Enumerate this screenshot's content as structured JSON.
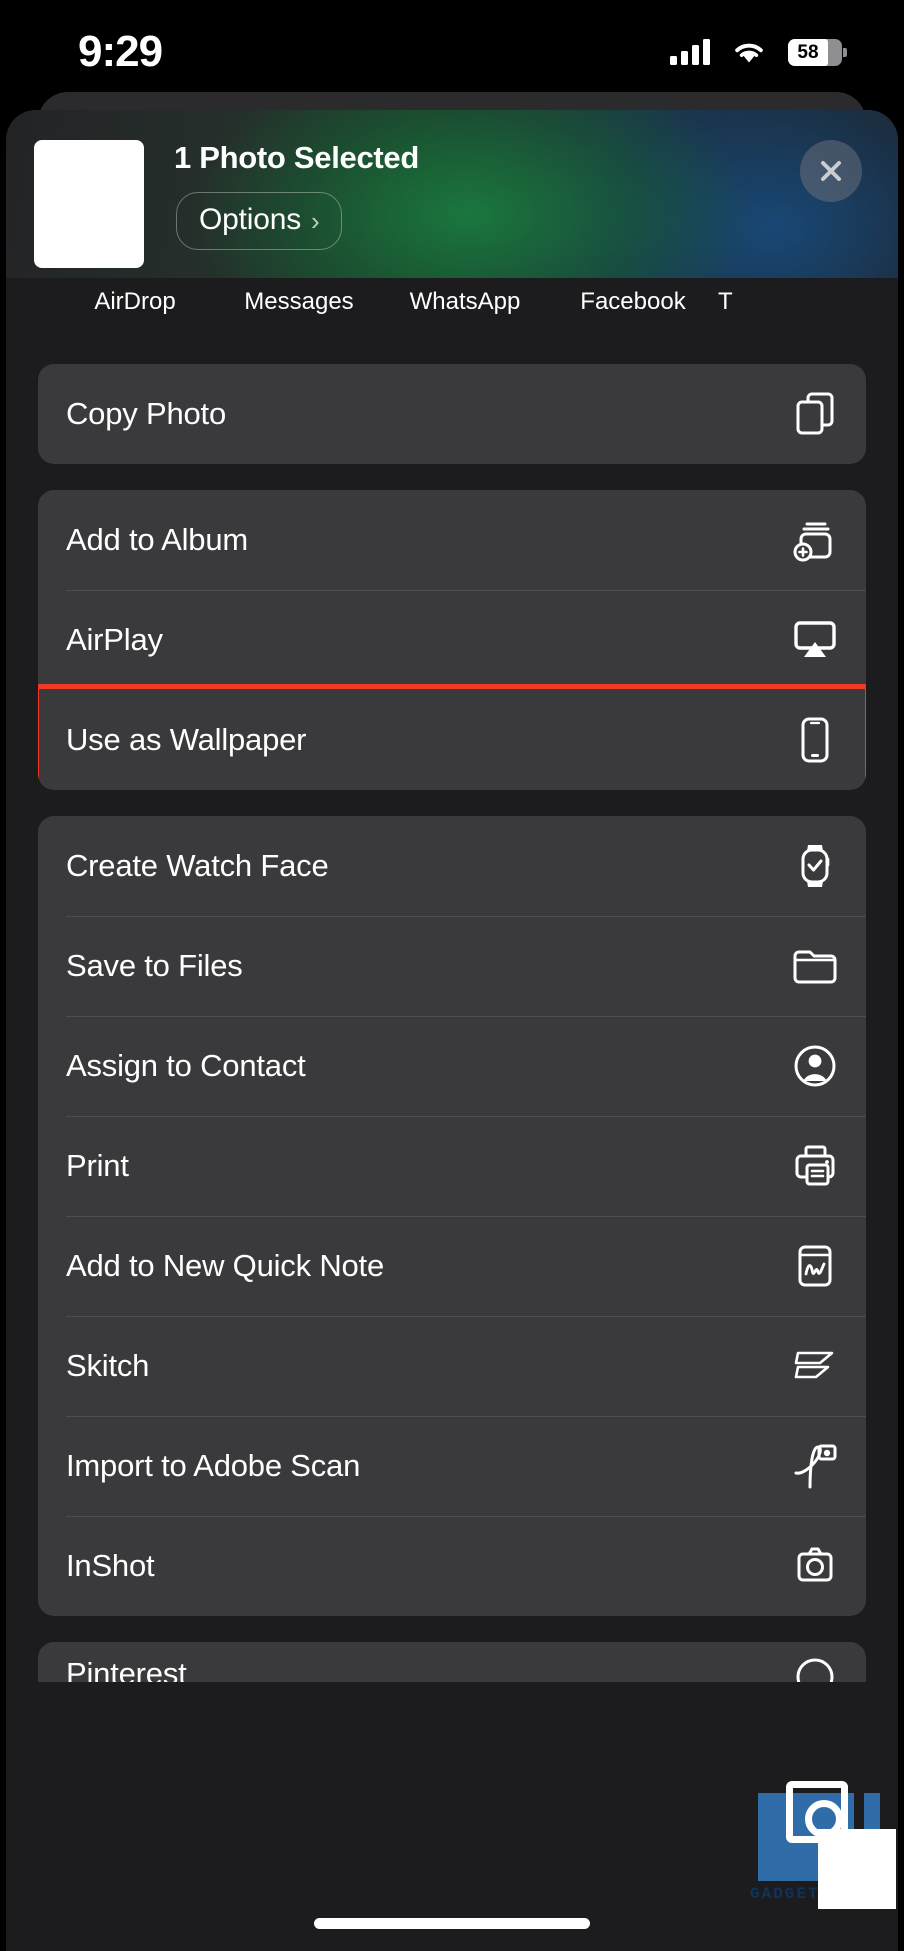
{
  "status_bar": {
    "time": "9:29",
    "battery_percent": "58",
    "signal_icon": "cellular-bars-icon",
    "wifi_icon": "wifi-icon",
    "battery_icon": "battery-icon"
  },
  "share_sheet": {
    "header": {
      "title": "1 Photo Selected",
      "options_label": "Options",
      "options_chevron": "chevron-right-icon",
      "close_icon": "close-icon",
      "thumbnail": "photo-thumbnail"
    },
    "apps": [
      {
        "label": "AirDrop"
      },
      {
        "label": "Messages"
      },
      {
        "label": "WhatsApp"
      },
      {
        "label": "Facebook"
      },
      {
        "label": "T"
      }
    ],
    "groups": [
      {
        "rows": [
          {
            "label": "Copy Photo",
            "icon": "copy-documents-icon",
            "highlighted": false
          }
        ]
      },
      {
        "rows": [
          {
            "label": "Add to Album",
            "icon": "add-to-album-icon",
            "highlighted": false
          },
          {
            "label": "AirPlay",
            "icon": "airplay-icon",
            "highlighted": false
          },
          {
            "label": "Use as Wallpaper",
            "icon": "iphone-icon",
            "highlighted": true
          }
        ]
      },
      {
        "rows": [
          {
            "label": "Create Watch Face",
            "icon": "apple-watch-icon",
            "highlighted": false
          },
          {
            "label": "Save to Files",
            "icon": "folder-icon",
            "highlighted": false
          },
          {
            "label": "Assign to Contact",
            "icon": "contact-person-icon",
            "highlighted": false
          },
          {
            "label": "Print",
            "icon": "printer-icon",
            "highlighted": false
          },
          {
            "label": "Add to New Quick Note",
            "icon": "quick-note-icon",
            "highlighted": false
          },
          {
            "label": "Skitch",
            "icon": "skitch-icon",
            "highlighted": false
          },
          {
            "label": "Import to Adobe Scan",
            "icon": "adobe-scan-icon",
            "highlighted": false
          },
          {
            "label": "InShot",
            "icon": "inshot-icon",
            "highlighted": false
          }
        ]
      }
    ],
    "partial_row": {
      "label": "Pinterest",
      "icon": "pinterest-icon"
    }
  },
  "watermark": {
    "text": "GADGETS",
    "logo_icon": "gadgets-camera-logo-icon"
  },
  "colors": {
    "highlight": "#ef3b25",
    "card": "#3a3a3c",
    "sheet_bg": "#1c1c1e",
    "watermark_blue": "#2f6ca8"
  }
}
